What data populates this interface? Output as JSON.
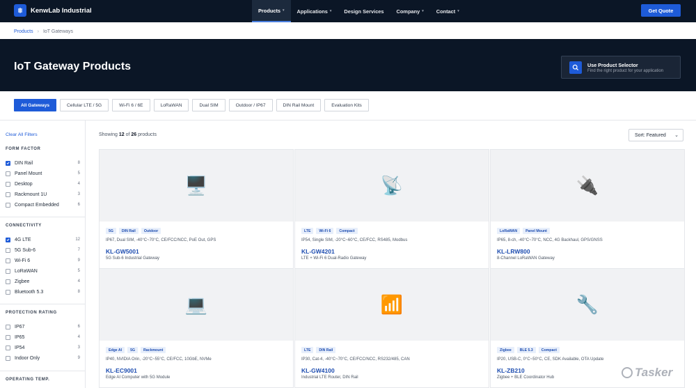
{
  "brand": {
    "name": "KenwLab Industrial"
  },
  "nav": {
    "items": [
      {
        "label": "Products",
        "caret": "▾",
        "active": true
      },
      {
        "label": "Applications",
        "caret": "▾"
      },
      {
        "label": "Design Services",
        "caret": ""
      },
      {
        "label": "Company",
        "caret": "▾"
      },
      {
        "label": "Contact",
        "caret": "▾"
      }
    ],
    "cta": "Get Quote"
  },
  "breadcrumb": {
    "root": "Products",
    "separator": "›",
    "current": "IoT Gateways"
  },
  "hero": {
    "title": "IoT Gateway Products",
    "selector": {
      "title": "Use Product Selector",
      "subtitle": "Find the right product for your application"
    }
  },
  "tabs": [
    "All Gateways",
    "Cellular LTE / 5G",
    "Wi-Fi 6 / 6E",
    "LoRaWAN",
    "Dual SIM",
    "Outdoor / IP67",
    "DIN Rail Mount",
    "Evaluation Kits"
  ],
  "sidebar": {
    "clear": "Clear All Filters",
    "groups": [
      {
        "title": "FORM FACTOR",
        "items": [
          {
            "label": "DIN Rail",
            "count": "8",
            "checked": true
          },
          {
            "label": "Panel Mount",
            "count": "5",
            "checked": false
          },
          {
            "label": "Desktop",
            "count": "4",
            "checked": false
          },
          {
            "label": "Rackmount 1U",
            "count": "3",
            "checked": false
          },
          {
            "label": "Compact Embedded",
            "count": "6",
            "checked": false
          }
        ]
      },
      {
        "title": "CONNECTIVITY",
        "items": [
          {
            "label": "4G LTE",
            "count": "12",
            "checked": true
          },
          {
            "label": "5G Sub-6",
            "count": "7",
            "checked": false
          },
          {
            "label": "Wi-Fi 6",
            "count": "9",
            "checked": false
          },
          {
            "label": "LoRaWAN",
            "count": "5",
            "checked": false
          },
          {
            "label": "Zigbee",
            "count": "4",
            "checked": false
          },
          {
            "label": "Bluetooth 5.3",
            "count": "8",
            "checked": false
          }
        ]
      },
      {
        "title": "PROTECTION RATING",
        "items": [
          {
            "label": "IP67",
            "count": "6",
            "checked": false
          },
          {
            "label": "IP65",
            "count": "4",
            "checked": false
          },
          {
            "label": "IP54",
            "count": "3",
            "checked": false
          },
          {
            "label": "Indoor Only",
            "count": "9",
            "checked": false
          }
        ]
      },
      {
        "title": "OPERATING TEMP.",
        "items": []
      }
    ]
  },
  "results": {
    "showing_prefix": "Showing",
    "shown": "12",
    "of": "of",
    "total": "26",
    "suffix": "products",
    "sort": "Sort: Featured"
  },
  "products": [
    {
      "icon": "🖥️",
      "icon_name": "desktop-computer-icon",
      "tags": [
        "5G",
        "DIN Rail",
        "Outdoor"
      ],
      "specs": "IP67, Dual SIM, -40°C~70°C, CE/FCC/NCC, PoE Out, GPS",
      "sku": "KL-GW5001",
      "desc": "5G Sub-6 Industrial Gateway"
    },
    {
      "icon": "📡",
      "icon_name": "satellite-dish-icon",
      "tags": [
        "LTE",
        "Wi-Fi 6",
        "Compact"
      ],
      "specs": "IP54, Single SIM, -20°C~60°C, CE/FCC, RS485, Modbus",
      "sku": "KL-GW4201",
      "desc": "LTE + Wi-Fi 6 Dual-Radio Gateway"
    },
    {
      "icon": "🔌",
      "icon_name": "power-plug-icon",
      "tags": [
        "LoRaWAN",
        "Panel Mount"
      ],
      "specs": "IP65, 8-ch, -40°C~70°C, NCC, 4G Backhaul, GPS/GNSS",
      "sku": "KL-LRW800",
      "desc": "8-Channel LoRaWAN Gateway"
    },
    {
      "icon": "💻",
      "icon_name": "laptop-icon",
      "tags": [
        "Edge AI",
        "5G",
        "Rackmount"
      ],
      "specs": "IP40, NVIDIA Orin, -20°C~55°C, CE/FCC, 10GbE, NVMe",
      "sku": "KL-EC9001",
      "desc": "Edge AI Computer with 5G Module"
    },
    {
      "icon": "📶",
      "icon_name": "signal-bars-icon",
      "tags": [
        "LTE",
        "DIN Rail"
      ],
      "specs": "IP30, Cat-4, -40°C~70°C, CE/FCC/NCC, RS232/485, CAN",
      "sku": "KL-GW4100",
      "desc": "Industrial LTE Router, DIN Rail"
    },
    {
      "icon": "🔧",
      "icon_name": "wrench-icon",
      "tags": [
        "Zigbee",
        "BLE 5.3",
        "Compact"
      ],
      "specs": "IP20, USB-C, 0°C~50°C, CE, SDK Available, OTA Update",
      "sku": "KL-ZB210",
      "desc": "Zigbee + BLE Coordinator Hub"
    }
  ],
  "watermark": "Tasker"
}
